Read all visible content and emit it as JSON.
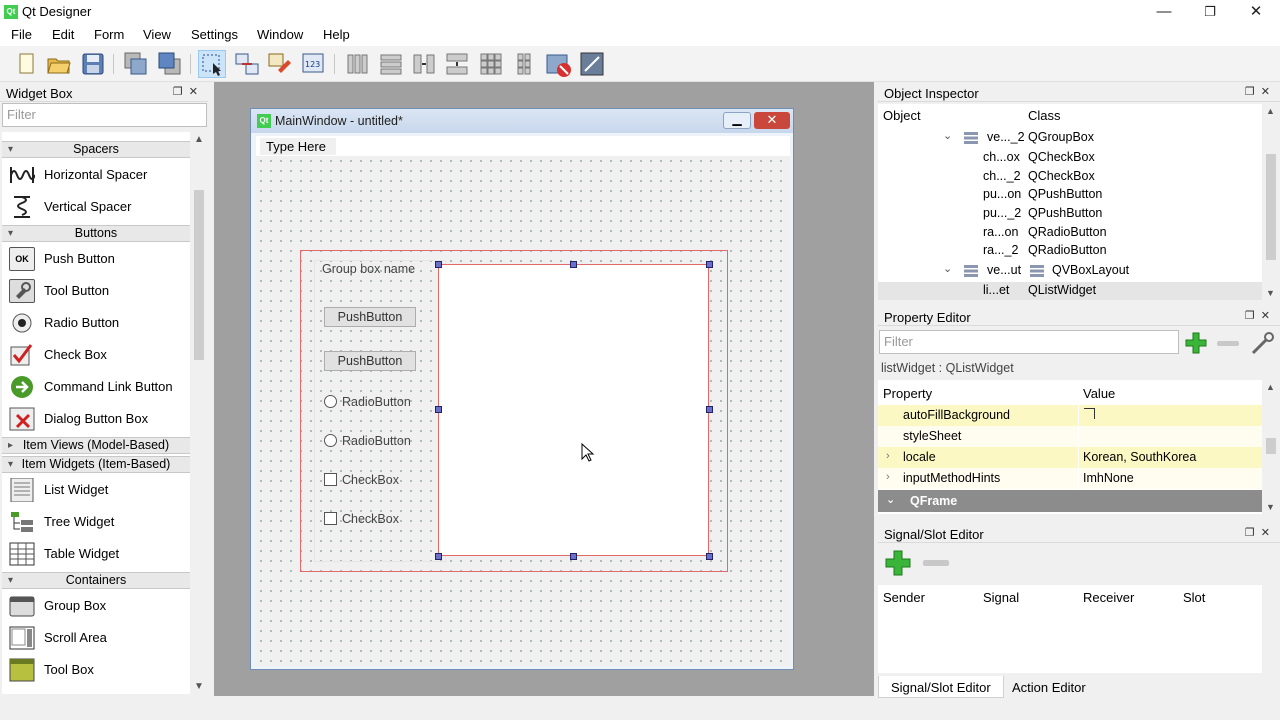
{
  "app": {
    "title": "Qt Designer",
    "logo_text": "Qt"
  },
  "window_controls": {
    "minimize": "—",
    "restore": "❐",
    "close": "✕"
  },
  "menu": [
    "File",
    "Edit",
    "Form",
    "View",
    "Settings",
    "Window",
    "Help"
  ],
  "widget_box": {
    "title": "Widget Box",
    "filter_placeholder": "Filter",
    "categories": {
      "spacers": "Spacers",
      "buttons": "Buttons",
      "item_views": "Item Views (Model-Based)",
      "item_widgets": "Item Widgets (Item-Based)",
      "containers": "Containers"
    },
    "items": {
      "horizontal_spacer": "Horizontal Spacer",
      "vertical_spacer": "Vertical Spacer",
      "push_button": "Push Button",
      "tool_button": "Tool Button",
      "radio_button": "Radio Button",
      "check_box": "Check Box",
      "command_link_button": "Command Link Button",
      "dialog_button_box": "Dialog Button Box",
      "list_widget": "List Widget",
      "tree_widget": "Tree Widget",
      "table_widget": "Table Widget",
      "group_box": "Group Box",
      "scroll_area": "Scroll Area",
      "tool_box": "Tool Box"
    }
  },
  "form": {
    "title": "MainWindow - untitled*",
    "menu_placeholder": "Type Here",
    "group_box_name": "Group box name",
    "push_button_1": "PushButton",
    "push_button_2": "PushButton",
    "radio_1": "RadioButton",
    "radio_2": "RadioButton",
    "check_1": "CheckBox",
    "check_2": "CheckBox"
  },
  "object_inspector": {
    "title": "Object Inspector",
    "columns": {
      "object": "Object",
      "class": "Class"
    },
    "rows": [
      {
        "object": "ve..._2",
        "class": "QGroupBox"
      },
      {
        "object": "ch...ox",
        "class": "QCheckBox"
      },
      {
        "object": "ch..._2",
        "class": "QCheckBox"
      },
      {
        "object": "pu...on",
        "class": "QPushButton"
      },
      {
        "object": "pu..._2",
        "class": "QPushButton"
      },
      {
        "object": "ra...on",
        "class": "QRadioButton"
      },
      {
        "object": "ra..._2",
        "class": "QRadioButton"
      },
      {
        "object": "ve...ut",
        "class": "QVBoxLayout"
      },
      {
        "object": "li...et",
        "class": "QListWidget"
      }
    ]
  },
  "property_editor": {
    "title": "Property Editor",
    "filter_placeholder": "Filter",
    "class_label": "listWidget : QListWidget",
    "columns": {
      "property": "Property",
      "value": "Value"
    },
    "rows": [
      {
        "property": "autoFillBackground",
        "value": ""
      },
      {
        "property": "styleSheet",
        "value": ""
      },
      {
        "property": "locale",
        "value": "Korean, SouthKorea"
      },
      {
        "property": "inputMethodHints",
        "value": "ImhNone"
      }
    ],
    "group": "QFrame"
  },
  "signal_slot_editor": {
    "title": "Signal/Slot Editor",
    "columns": {
      "sender": "Sender",
      "signal": "Signal",
      "receiver": "Receiver",
      "slot": "Slot"
    },
    "tabs": {
      "signal_slot": "Signal/Slot Editor",
      "action": "Action Editor"
    }
  }
}
